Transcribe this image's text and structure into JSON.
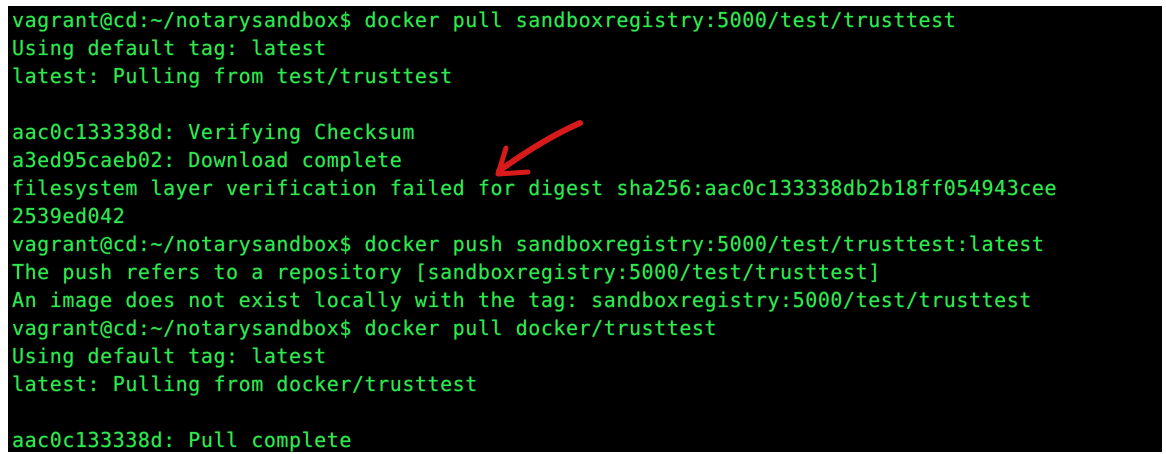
{
  "terminal": {
    "text_color": "#2ee84f",
    "background_color": "#000000",
    "annotation_color": "#d81a1a",
    "annotation_icon": "red-arrow-icon",
    "lines": [
      "vagrant@cd:~/notarysandbox$ docker pull sandboxregistry:5000/test/trusttest",
      "Using default tag: latest",
      "latest: Pulling from test/trusttest",
      "",
      "aac0c133338d: Verifying Checksum",
      "a3ed95caeb02: Download complete",
      "filesystem layer verification failed for digest sha256:aac0c133338db2b18ff054943cee",
      "2539ed042",
      "vagrant@cd:~/notarysandbox$ docker push sandboxregistry:5000/test/trusttest:latest",
      "The push refers to a repository [sandboxregistry:5000/test/trusttest]",
      "An image does not exist locally with the tag: sandboxregistry:5000/test/trusttest",
      "vagrant@cd:~/notarysandbox$ docker pull docker/trusttest",
      "Using default tag: latest",
      "latest: Pulling from docker/trusttest",
      "",
      "aac0c133338d: Pull complete"
    ]
  }
}
